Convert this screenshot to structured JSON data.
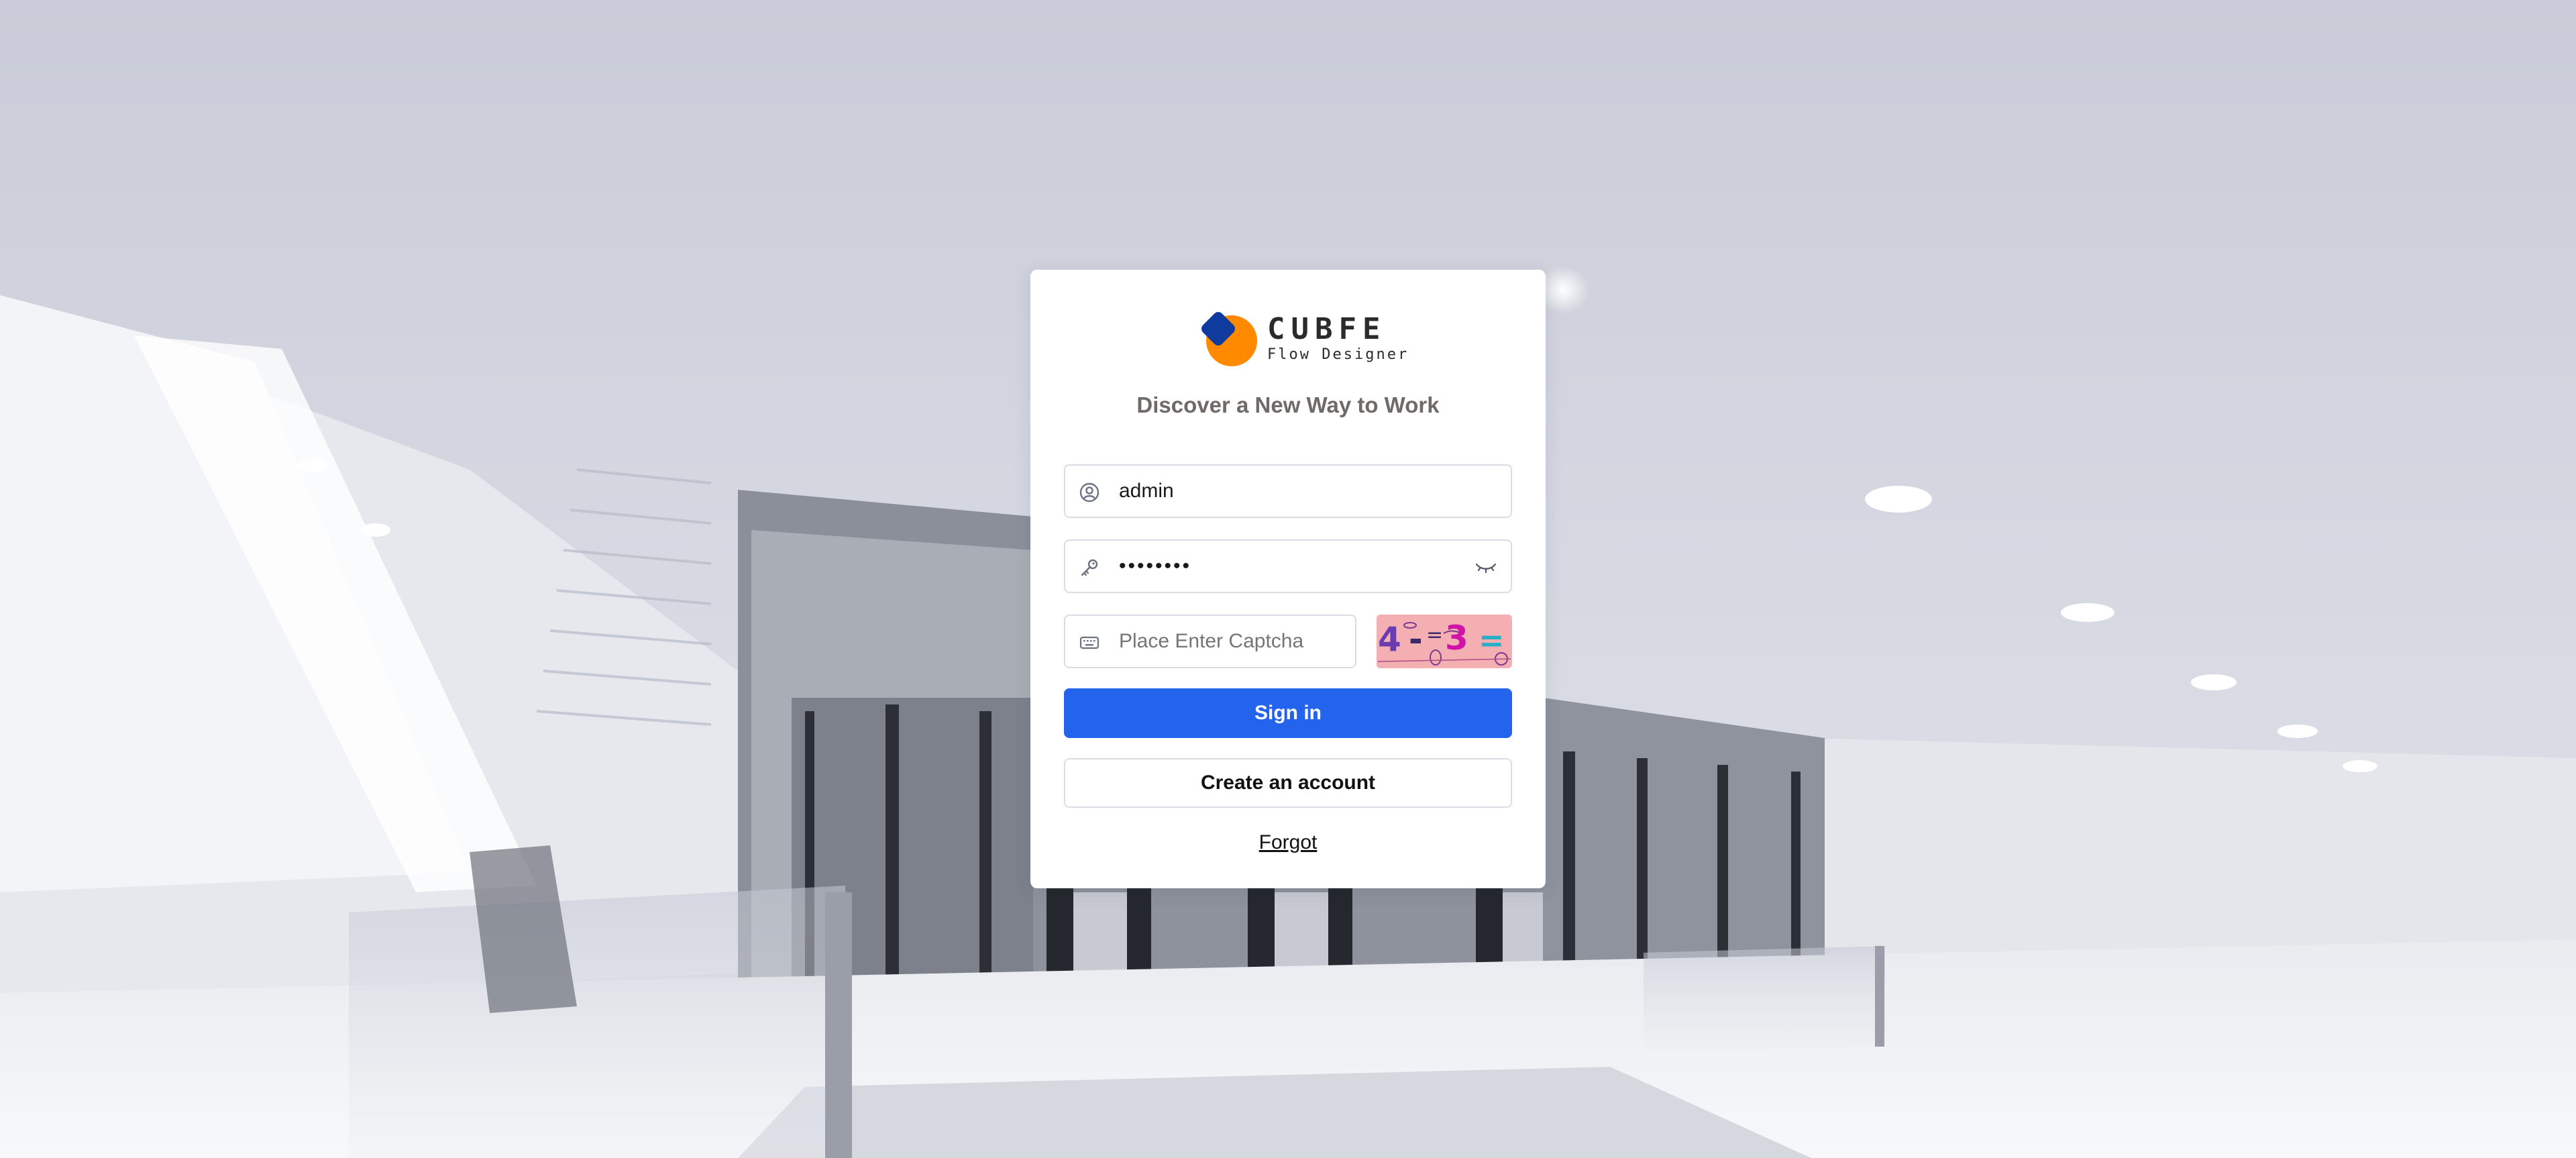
{
  "brand": {
    "name": "CUBFE",
    "subtitle": "Flow Designer",
    "tagline": "Discover a New Way to Work",
    "colors": {
      "mark_primary": "#ff8a00",
      "mark_secondary": "#0f3a9e"
    }
  },
  "login": {
    "username": {
      "icon": "user-circle-icon",
      "value": "admin"
    },
    "password": {
      "icon": "key-icon",
      "value": "••••••••",
      "toggle_icon": "eye-closed-icon"
    },
    "captcha": {
      "icon": "keyboard-icon",
      "placeholder": "Place Enter Captcha",
      "image_text": "4-=3"
    },
    "signin_label": "Sign in",
    "create_label": "Create an account",
    "forgot_label": "Forgot"
  },
  "colors": {
    "primary_button": "#2463eb",
    "border": "#d9dde4",
    "tagline": "#6f6a68"
  }
}
